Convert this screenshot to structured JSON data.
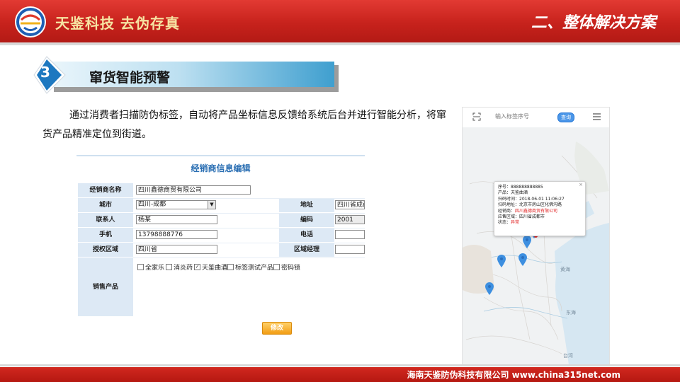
{
  "header": {
    "brand_text": "天鉴科技  去伪存真",
    "section_title": "二、整体解决方案"
  },
  "section": {
    "number": "3",
    "title": "窜货智能预警",
    "description": "通过消费者扫描防伪标签，自动将产品坐标信息反馈给系统后台并进行智能分析，将窜货产品精准定位到街道。"
  },
  "form": {
    "title": "经销商信息编辑",
    "labels": {
      "dealer_name": "经销商名称",
      "city": "城市",
      "contact": "联系人",
      "mobile": "手机",
      "auth_area": "授权区域",
      "products": "销售产品",
      "address": "地址",
      "code": "编码",
      "phone": "电话",
      "area_manager": "区域经理"
    },
    "values": {
      "dealer_name": "四川鑫德商贸有限公司",
      "city": "四川-成都",
      "contact": "杨某",
      "mobile": "13798888776",
      "auth_area": "四川省",
      "address": "四川省成都",
      "code": "2001",
      "phone": "",
      "area_manager": ""
    },
    "products": [
      {
        "label": "全家乐",
        "checked": false
      },
      {
        "label": "消炎药",
        "checked": false
      },
      {
        "label": "天鉴曲酒",
        "checked": true
      },
      {
        "label": "标签测试产品",
        "checked": false
      },
      {
        "label": "密码锁",
        "checked": false
      }
    ],
    "edit_button": "修改"
  },
  "map": {
    "search_placeholder": "输入标签序号",
    "query_button": "查询",
    "labels": {
      "yellow_sea": "黄海",
      "east_sea": "东海",
      "taiwan": "台湾"
    },
    "popup": {
      "serial": "序号：888888888885",
      "product": "产品：天鉴曲酒",
      "scan_time": "扫码时间：2018-06-01 11:06:27",
      "scan_address": "扫码地址：北京市房山区化佛沟路",
      "dealer_label": "经销商：",
      "dealer": "四川鑫德商贸有限公司",
      "area": "应售区域：四川省成都市",
      "status_label": "状态：",
      "status": "异常"
    }
  },
  "footer": {
    "text": "海南天鉴防伪科技有限公司   www.china315net.com"
  },
  "colors": {
    "brand_red": "#c7221c",
    "accent_blue": "#2b6fb3",
    "alert_red": "#e02020",
    "map_pin_blue": "#3d8fe0"
  }
}
